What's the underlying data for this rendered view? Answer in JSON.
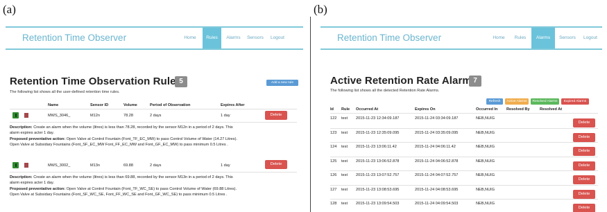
{
  "panel_a": {
    "letter": "(a)",
    "brand": "Retention Time Observer",
    "nav": [
      "Home",
      "Rules",
      "Alarms",
      "Sensors",
      "Logout"
    ],
    "active_nav": "Rules",
    "title": "Retention Time Observation Rules",
    "count": "5",
    "subtitle": "The following list shows all the user-defined retention time rules.",
    "add_rule_label": "Add a new rule",
    "columns": [
      "Name",
      "Sensor ID",
      "Volume",
      "Period of Observation",
      "Expires After"
    ],
    "rules": [
      {
        "name": "MWS_3046_",
        "sensor_id": "M12n",
        "volume": "78.28",
        "period": "2 days",
        "expires": "1 day",
        "delete_label": "Delete",
        "description_label": "Description:",
        "description_1": "Create an alarm when the volume (litres) is less than 78.28, recorded by the sensor M12n in a period of 2 days. This",
        "description_2": "alarm expires acter 1 day.",
        "action_label": "Proposed preventative action:",
        "action_1": "Open Valve at Control Fountain (Font_TF_EC_MW) to pass Control Volume of Water (14.27 Litres).",
        "action_2": "Open Valve at Subsidary Fountains (Font_SF_EC_MW Font_FF_EC_MW and Font_GF_EC_MW) to pass minimum 0.5 Litres ."
      },
      {
        "name": "MWS_3002_",
        "sensor_id": "M13n",
        "volume": "69.88",
        "period": "2 days",
        "expires": "1 day",
        "delete_label": "Delete",
        "description_label": "Description:",
        "description_1": "Create an alarm when the volume (litres) is less than 69.88, recorded by the sensor M13n in a period of 2 days. This",
        "description_2": "alarm expires acter 1 day.",
        "action_label": "Proposed preventative action:",
        "action_1": "Open Valve at Control Fountain (Font_TF_WC_SE) to pass Control Volume of Water (69.88 Litres).",
        "action_2": "Open Valve at Subsidary Fountains (Font_SF_WC_SE, Font_FF_WC_SE and Font_GF_WC_SE) to pass minimum 0.5 Litres ."
      }
    ]
  },
  "panel_b": {
    "letter": "(b)",
    "brand": "Retention Time Observer",
    "nav": [
      "Home",
      "Rules",
      "Alarms",
      "Sensors",
      "Logout"
    ],
    "active_nav": "Alarms",
    "title": "Active Retention Rate Alarms",
    "count": "7",
    "subtitle": "The following list shows all the detected Retention Rate Alarms.",
    "filters": [
      {
        "label": "Refresh",
        "color": "#5b9bd5"
      },
      {
        "label": "Active Alarms",
        "color": "#f0ad4e"
      },
      {
        "label": "Resolved Alarms",
        "color": "#5cb85c"
      },
      {
        "label": "Expired Alarms",
        "color": "#d9534f"
      }
    ],
    "columns": [
      "Id",
      "Rule",
      "Occurred At",
      "Expires On",
      "Occurred In",
      "Resolved By",
      "Resolved At"
    ],
    "alarms": [
      {
        "id": "122",
        "rule": "test",
        "occurred_at": "2015-11-23 12:34:09.187",
        "expires_on": "2015-11-24 03:34:09.187",
        "occurred_in": "NEB,NUIG",
        "delete_label": "Delete"
      },
      {
        "id": "123",
        "rule": "test",
        "occurred_at": "2015-11-23 12:35:09.095",
        "expires_on": "2015-11-24 03:35:09.095",
        "occurred_in": "NEB,NUIG",
        "delete_label": "Delete"
      },
      {
        "id": "124",
        "rule": "test",
        "occurred_at": "2015-11-23 13:06:11.42",
        "expires_on": "2015-11-24 04:06:11.42",
        "occurred_in": "NEB,NUIG",
        "delete_label": "Delete"
      },
      {
        "id": "125",
        "rule": "test",
        "occurred_at": "2015-11-23 13:06:52.878",
        "expires_on": "2015-11-24 04:06:52.878",
        "occurred_in": "NEB,NUIG",
        "delete_label": "Delete"
      },
      {
        "id": "126",
        "rule": "test",
        "occurred_at": "2015-11-23 13:07:52.757",
        "expires_on": "2015-11-24 04:07:52.757",
        "occurred_in": "NEB,NUIG",
        "delete_label": "Delete"
      },
      {
        "id": "127",
        "rule": "test",
        "occurred_at": "2015-11-23 13:08:53.695",
        "expires_on": "2015-11-24 04:08:53.695",
        "occurred_in": "NEB,NUIG",
        "delete_label": "Delete"
      },
      {
        "id": "128",
        "rule": "test",
        "occurred_at": "2015-11-23 13:09:54.503",
        "expires_on": "2015-11-24 04:09:54.503",
        "occurred_in": "NEB,NUIG",
        "delete_label": "Delete"
      }
    ]
  }
}
